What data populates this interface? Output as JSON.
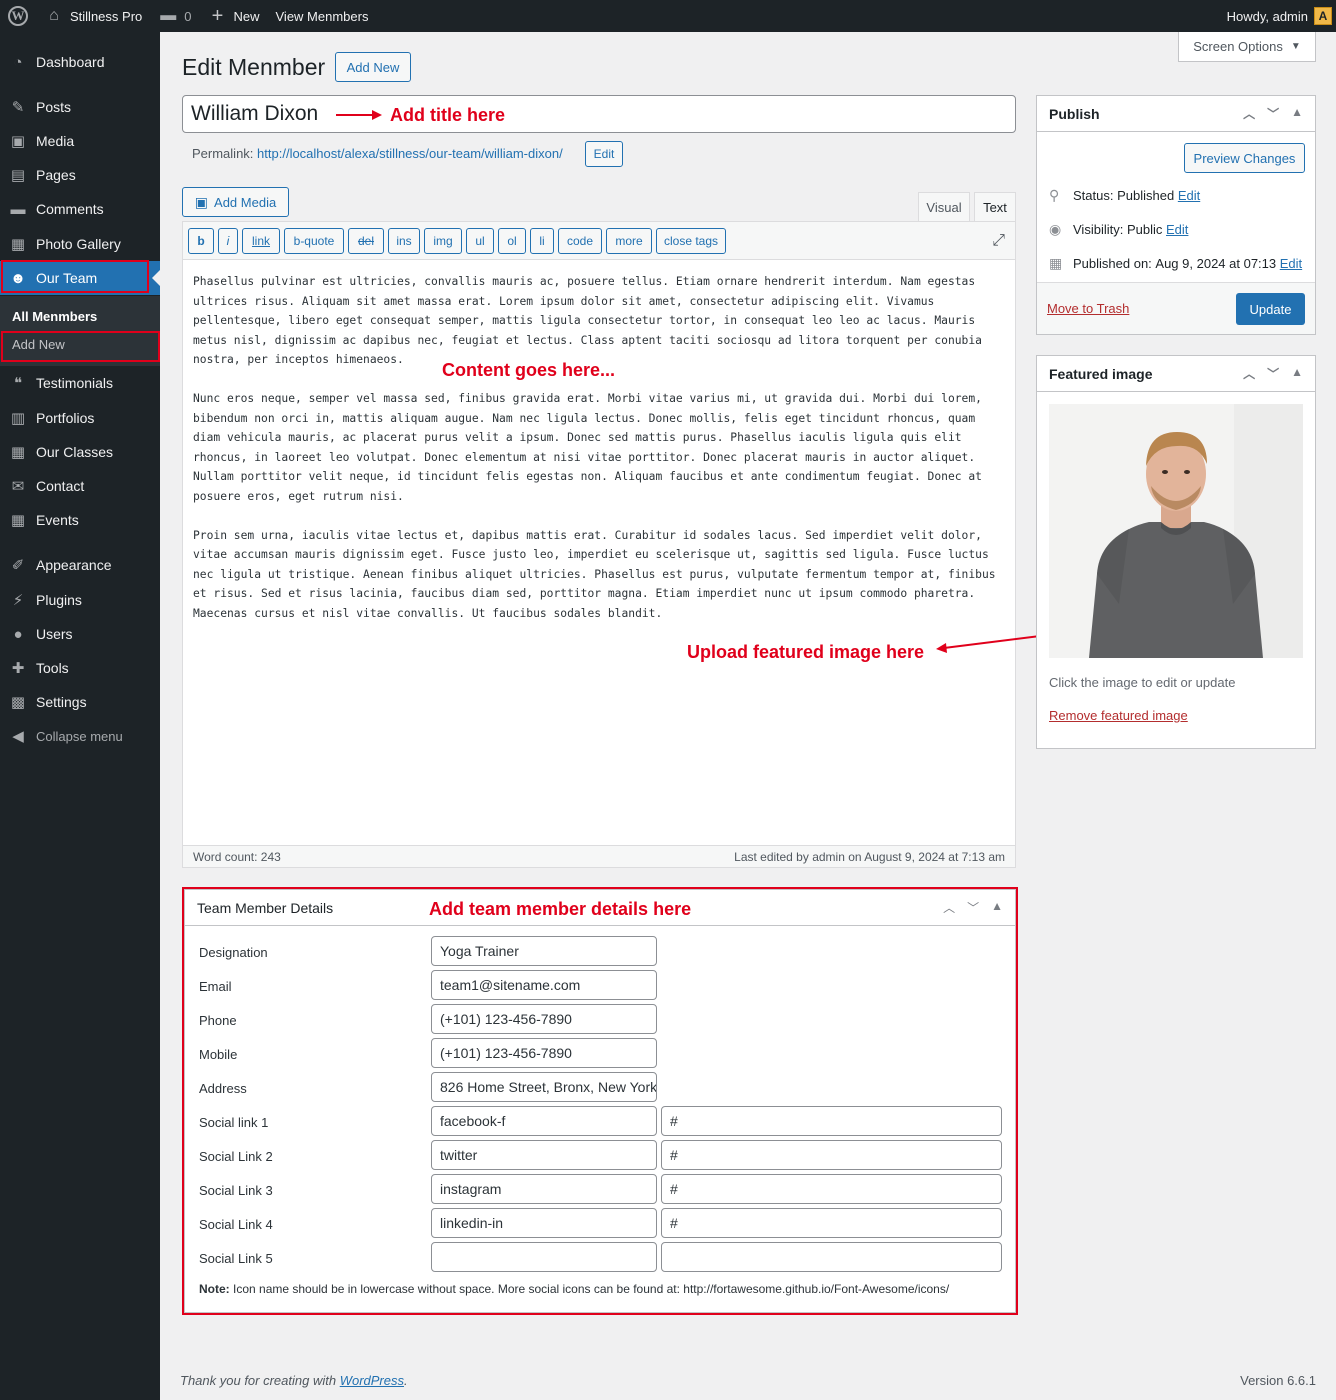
{
  "adminbar": {
    "site_name": "Stillness Pro",
    "comments_count": "0",
    "new_label": "New",
    "view_label": "View Menmbers",
    "greeting": "Howdy, admin"
  },
  "sidebar": {
    "items": [
      {
        "label": "Dashboard"
      },
      {
        "label": "Posts"
      },
      {
        "label": "Media"
      },
      {
        "label": "Pages"
      },
      {
        "label": "Comments"
      },
      {
        "label": "Photo Gallery"
      },
      {
        "label": "Our Team"
      },
      {
        "label": "Testimonials"
      },
      {
        "label": "Portfolios"
      },
      {
        "label": "Our Classes"
      },
      {
        "label": "Contact"
      },
      {
        "label": "Events"
      },
      {
        "label": "Appearance"
      },
      {
        "label": "Plugins"
      },
      {
        "label": "Users"
      },
      {
        "label": "Tools"
      },
      {
        "label": "Settings"
      }
    ],
    "submenu": {
      "all": "All Menmbers",
      "add_new": "Add New"
    },
    "collapse": "Collapse menu"
  },
  "screen_options": "Screen Options",
  "page": {
    "title": "Edit Menmber",
    "add_new": "Add New",
    "post_title": "William Dixon",
    "permalink_label": "Permalink:",
    "permalink_base": "http://localhost/alexa/stillness/our-team/",
    "permalink_slug": "william-dixon",
    "permalink_end": "/",
    "edit_btn": "Edit"
  },
  "annotations": {
    "title": "Add title here",
    "content": "Content goes here...",
    "featured": "Upload featured image here",
    "details": "Add team member details here"
  },
  "editor": {
    "add_media": "Add Media",
    "tab_visual": "Visual",
    "tab_text": "Text",
    "quicktags": [
      "b",
      "i",
      "link",
      "b-quote",
      "del",
      "ins",
      "img",
      "ul",
      "ol",
      "li",
      "code",
      "more",
      "close tags"
    ],
    "paragraphs": [
      "Phasellus pulvinar est ultricies, convallis mauris ac, posuere tellus. Etiam ornare hendrerit interdum. Nam egestas ultrices risus. Aliquam sit amet massa erat. Lorem ipsum dolor sit amet, consectetur adipiscing elit. Vivamus pellentesque, libero eget consequat semper, mattis ligula consectetur tortor, in consequat leo leo ac lacus. Mauris metus nisl, dignissim ac dapibus nec, feugiat et lectus. Class aptent taciti sociosqu ad litora torquent per conubia nostra, per inceptos himenaeos.",
      "Nunc eros neque, semper vel massa sed, finibus gravida erat. Morbi vitae varius mi, ut gravida dui. Morbi dui lorem, bibendum non orci in, mattis aliquam augue. Nam nec ligula lectus. Donec mollis, felis eget tincidunt rhoncus, quam diam vehicula mauris, ac placerat purus velit a ipsum. Donec sed mattis purus. Phasellus iaculis ligula quis elit rhoncus, in laoreet leo volutpat. Donec elementum at nisi vitae porttitor. Donec placerat mauris in auctor aliquet. Nullam porttitor velit neque, id tincidunt felis egestas non. Aliquam faucibus et ante condimentum feugiat. Donec at posuere eros, eget rutrum nisi.",
      "Proin sem urna, iaculis vitae lectus et, dapibus mattis erat. Curabitur id sodales lacus. Sed imperdiet velit dolor, vitae accumsan mauris dignissim eget. Fusce justo leo, imperdiet eu scelerisque ut, sagittis sed ligula. Fusce luctus nec ligula ut tristique. Aenean finibus aliquet ultricies. Phasellus est purus, vulputate fermentum tempor at, finibus et risus. Sed et risus lacinia, faucibus diam sed, porttitor magna. Etiam imperdiet nunc ut ipsum commodo pharetra. Maecenas cursus et nisl vitae convallis. Ut faucibus sodales blandit."
    ],
    "word_count": "Word count: 243",
    "last_edited": "Last edited by admin on August 9, 2024 at 7:13 am"
  },
  "publish": {
    "title": "Publish",
    "preview": "Preview Changes",
    "status_label": "Status:",
    "status_value": "Published",
    "visibility_label": "Visibility:",
    "visibility_value": "Public",
    "published_label": "Published on:",
    "published_value": "Aug 9, 2024 at 07:13",
    "edit": "Edit",
    "trash": "Move to Trash",
    "update": "Update"
  },
  "featured": {
    "title": "Featured image",
    "hint": "Click the image to edit or update",
    "remove": "Remove featured image"
  },
  "details": {
    "title": "Team Member Details",
    "rows": [
      {
        "label": "Designation",
        "value": "Yoga Trainer"
      },
      {
        "label": "Email",
        "value": "team1@sitename.com"
      },
      {
        "label": "Phone",
        "value": "(+101) 123-456-7890"
      },
      {
        "label": "Mobile",
        "value": "(+101) 123-456-7890"
      },
      {
        "label": "Address",
        "value": "826 Home Street, Bronx, New York"
      },
      {
        "label": "Social link 1",
        "value": "facebook-f",
        "url": "#"
      },
      {
        "label": "Social Link 2",
        "value": "twitter",
        "url": "#"
      },
      {
        "label": "Social Link 3",
        "value": "instagram",
        "url": "#"
      },
      {
        "label": "Social Link 4",
        "value": "linkedin-in",
        "url": "#"
      },
      {
        "label": "Social Link 5",
        "value": "",
        "url": ""
      }
    ],
    "note_bold": "Note:",
    "note_text": " Icon name should be in lowercase without space. More social icons can be found at: http://fortawesome.github.io/Font-Awesome/icons/"
  },
  "footer": {
    "thanks": "Thank you for creating with ",
    "wp_link": "WordPress",
    "period": ".",
    "version": "Version 6.6.1"
  }
}
